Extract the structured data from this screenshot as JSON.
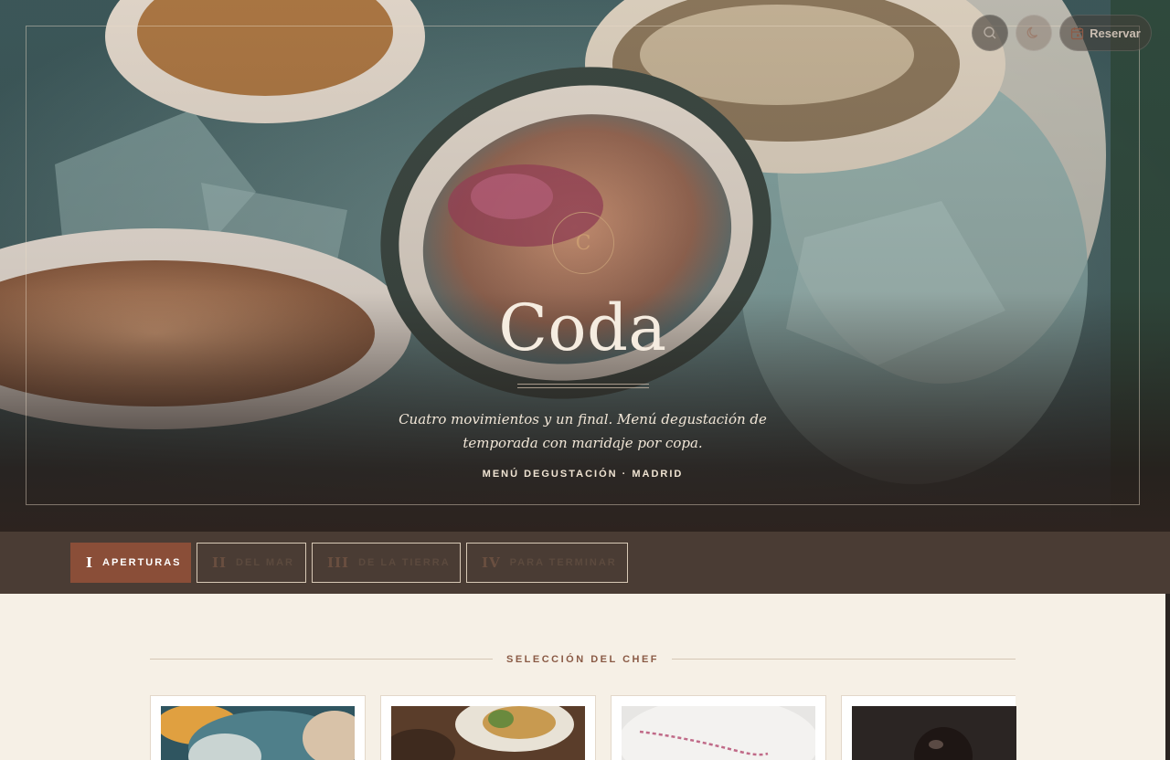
{
  "hero": {
    "monogram": "C",
    "title": "Coda",
    "description": "Cuatro movimientos y un final. Menú degustación de temporada con maridaje por copa.",
    "kicker": "MENÚ DEGUSTACIÓN · MADRID"
  },
  "header": {
    "search_icon": "search-icon",
    "theme_icon": "moon-icon",
    "reserve_icon": "calendar-icon",
    "reserve_label": "Reservar"
  },
  "tabs": [
    {
      "numeral": "I",
      "label": "APERTURAS",
      "active": true
    },
    {
      "numeral": "II",
      "label": "DEL MAR",
      "active": false
    },
    {
      "numeral": "III",
      "label": "DE LA TIERRA",
      "active": false
    },
    {
      "numeral": "IV",
      "label": "PARA TERMINAR",
      "active": false
    }
  ],
  "section": {
    "label": "SELECCIÓN DEL CHEF"
  },
  "colors": {
    "accent": "#8a4e38",
    "tabbar": "#4a3c34",
    "cream": "#f6f0e6"
  }
}
